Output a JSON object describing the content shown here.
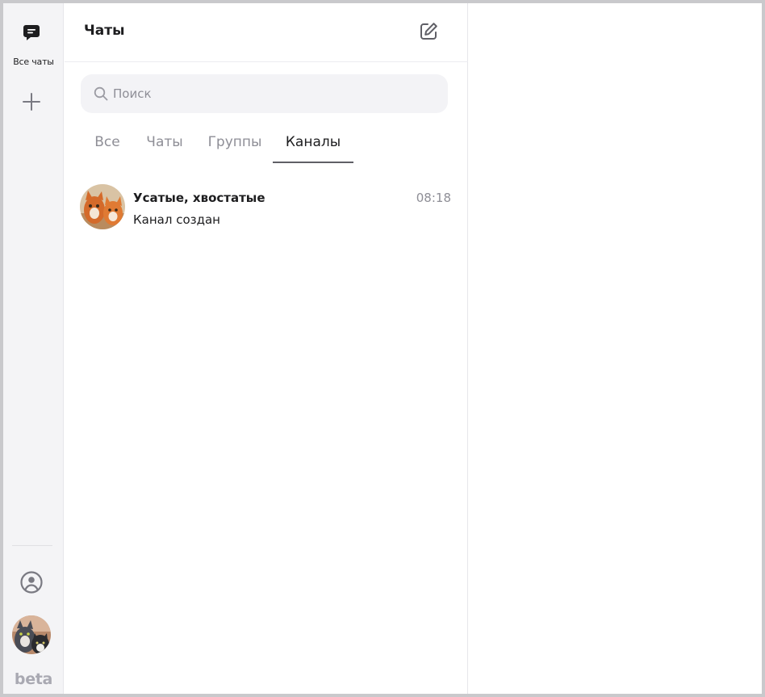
{
  "sidebar": {
    "all_chats_label": "Все чаты",
    "beta_label": "beta",
    "icons": [
      "chat-bubble-icon",
      "plus-icon",
      "profile-icon"
    ]
  },
  "chat_list": {
    "title": "Чаты",
    "search": {
      "placeholder": "Поиск",
      "value": ""
    },
    "tabs": [
      {
        "label": "Все",
        "active": false
      },
      {
        "label": "Чаты",
        "active": false
      },
      {
        "label": "Группы",
        "active": false
      },
      {
        "label": "Каналы",
        "active": true
      }
    ],
    "items": [
      {
        "name": "Усатые, хвостатые",
        "time": "08:18",
        "preview": "Канал создан"
      }
    ]
  },
  "colors": {
    "rail_bg": "#f4f4f6",
    "text_primary": "#1d1d1f",
    "text_secondary": "#8e8e96",
    "search_bg": "#f3f3f6",
    "tab_underline": "#5f5f66"
  }
}
